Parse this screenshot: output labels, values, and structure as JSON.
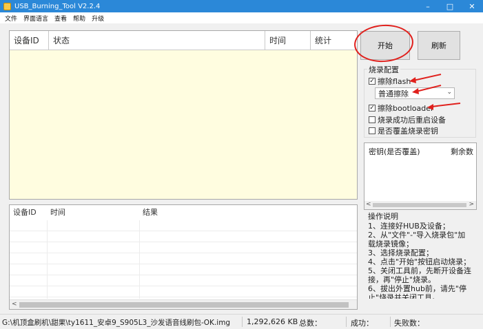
{
  "window": {
    "title": "USB_Burning_Tool V2.2.4",
    "minimize": "–",
    "maximize": "□",
    "close": "✕"
  },
  "menu": [
    "文件",
    "界面语言",
    "查看",
    "帮助",
    "升级"
  ],
  "main_table": {
    "columns": [
      "设备ID",
      "状态",
      "时间",
      "统计"
    ]
  },
  "log_table": {
    "columns": [
      "设备ID",
      "时间",
      "结果"
    ]
  },
  "buttons": {
    "start": "开始",
    "refresh": "刷新"
  },
  "burn_config": {
    "title": "烧录配置",
    "erase_flash": {
      "label": "擦除flash",
      "checked": true
    },
    "erase_mode": "普通擦除",
    "erase_bootloader": {
      "label": "擦除bootloader",
      "checked": true
    },
    "reboot_after": {
      "label": "烧录成功后重启设备",
      "checked": false
    },
    "overwrite_key": {
      "label": "是否覆盖烧录密钥",
      "checked": false
    }
  },
  "key_panel": {
    "col_key": "密钥(是否覆盖)",
    "col_remaining": "剩余数"
  },
  "instructions": {
    "title": "操作说明",
    "lines": [
      "1、连接好HUB及设备；",
      "2、从\"文件\"-\"导入烧录包\"加载烧录镜像；",
      "3、选择烧录配置；",
      "4、点击\"开始\"按钮启动烧录；",
      "5、关闭工具前，先断开设备连接，再\"停止\"烧录。",
      "6、拔出外置hub前，请先\"停止\"烧录并关闭工具。"
    ]
  },
  "status": {
    "path": "G:\\机顶盒刷机\\甜果\\ty1611_安卓9_S905L3_沙发语音线刷包-OK.img",
    "size": "1,292,626 KB",
    "total": "总数：",
    "success": "成功：",
    "fail": "失败数："
  },
  "colors": {
    "title_bar": "#2b88d8",
    "device_area": "#fffde0",
    "annotation": "#e0201c"
  }
}
